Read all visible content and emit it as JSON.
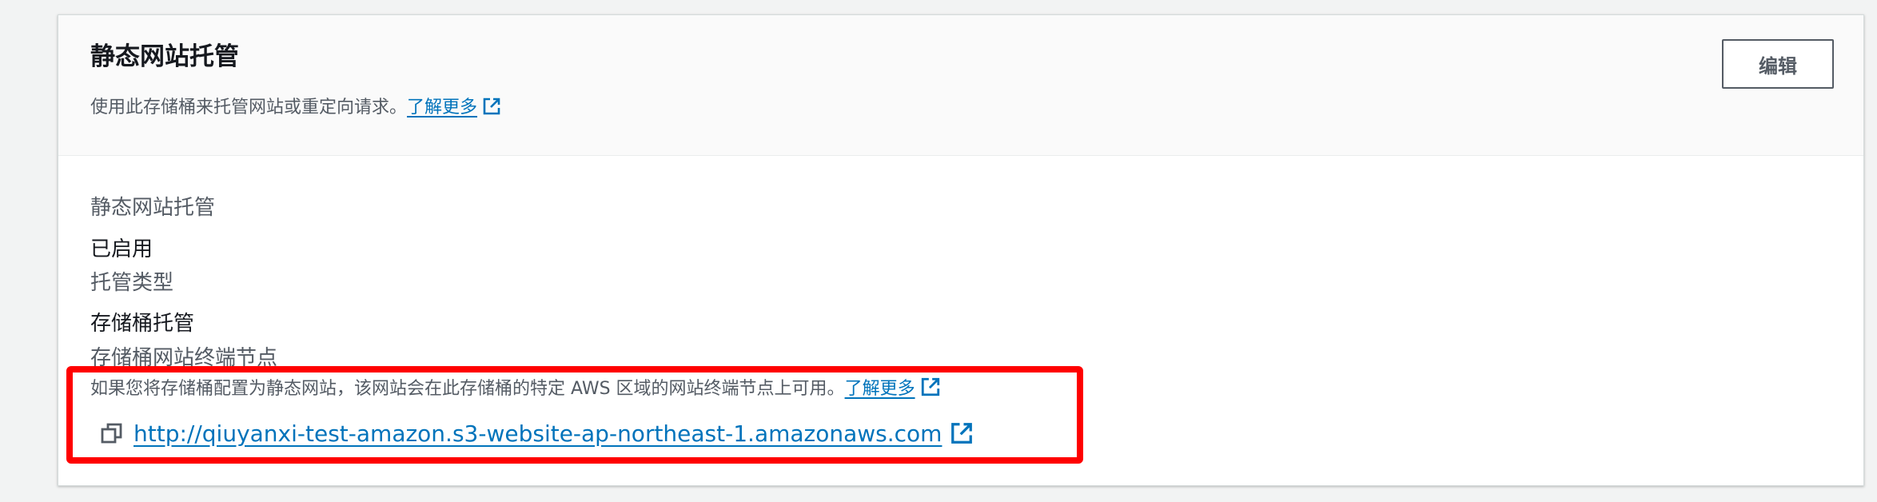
{
  "panel": {
    "title": "静态网站托管",
    "description": "使用此存储桶来托管网站或重定向请求。",
    "learn_more": "了解更多",
    "edit_label": "编辑"
  },
  "fields": {
    "hosting_label": "静态网站托管",
    "hosting_value": "已启用",
    "hosting_type_label": "托管类型",
    "hosting_type_value": "存储桶托管",
    "endpoint_label": "存储桶网站终端节点",
    "endpoint_help": "如果您将存储桶配置为静态网站，该网站会在此存储桶的特定 AWS 区域的网站终端节点上可用。",
    "endpoint_learn_more": "了解更多",
    "endpoint_url": "http://qiuyanxi-test-amazon.s3-website-ap-northeast-1.amazonaws.com"
  },
  "colors": {
    "link": "#0073bb",
    "highlight": "#ff0000",
    "text_primary": "#16191f",
    "text_secondary": "#545b64"
  },
  "icons": {
    "external_link": "external-link-icon",
    "copy": "copy-icon"
  }
}
